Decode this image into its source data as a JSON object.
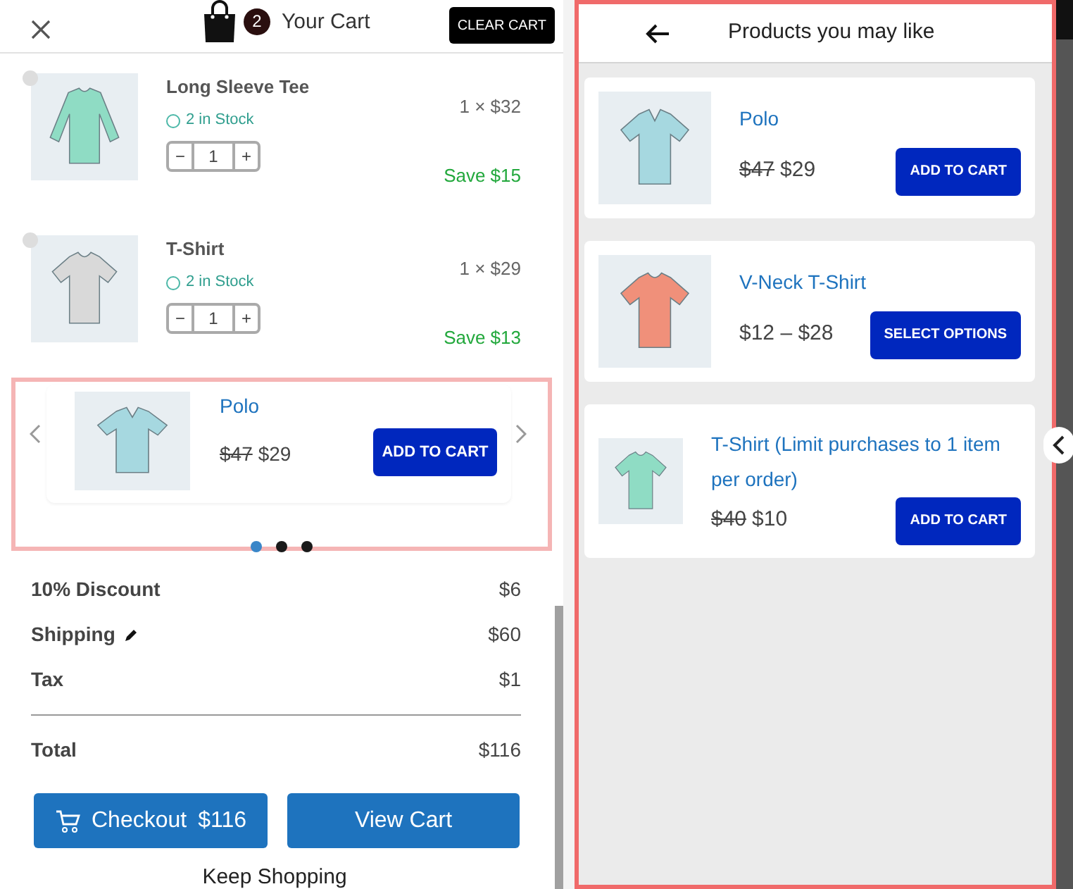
{
  "cart_header": {
    "count": "2",
    "title": "Your Cart",
    "clear_button": "CLEAR CART"
  },
  "quantity_buttons": {
    "minus": "−",
    "plus": "+"
  },
  "cart_items": [
    {
      "name": "Long Sleeve Tee",
      "stock": "2 in Stock",
      "quantity": "1",
      "price": "1 × $32",
      "savings": "Save $15",
      "kind": "long-sleeve",
      "color": "#8fdcc4"
    },
    {
      "name": "T-Shirt",
      "stock": "2 in Stock",
      "quantity": "1",
      "price": "1 × $29",
      "savings": "Save $13",
      "kind": "tee",
      "color": "#d9d9d9"
    }
  ],
  "carousel": {
    "item": {
      "name": "Polo",
      "old_price": "$47",
      "price": "$29",
      "button": "ADD TO CART",
      "kind": "polo",
      "color": "#a6d8e0"
    },
    "dots": [
      {
        "selected": true
      },
      {
        "selected": false
      },
      {
        "selected": false
      }
    ]
  },
  "summary": [
    {
      "label": "10% Discount",
      "value": "$6",
      "editable": false
    },
    {
      "label": "Shipping",
      "value": "$60",
      "editable": true
    },
    {
      "label": "Tax",
      "value": "$1",
      "editable": false
    }
  ],
  "total": {
    "label": "Total",
    "value": "$116"
  },
  "checkout_button": {
    "label": "Checkout",
    "amount": "$116"
  },
  "view_cart_button": "View Cart",
  "keep_shopping": "Keep Shopping",
  "suggestions": {
    "title": "Products you may like",
    "products": [
      {
        "name": "Polo",
        "old_price": "$47",
        "price": "$29",
        "button": "ADD TO CART",
        "kind": "polo",
        "color": "#a6d8e0"
      },
      {
        "name": "V-Neck T-Shirt",
        "price": "$12 – $28",
        "button": "SELECT OPTIONS",
        "kind": "tee",
        "color": "#f0907a"
      },
      {
        "name": "T-Shirt (Limit purchases to 1 item per order)",
        "old_price": "$40",
        "price": "$10",
        "button": "ADD TO CART",
        "kind": "tee",
        "color": "#8fdcc4"
      }
    ]
  }
}
